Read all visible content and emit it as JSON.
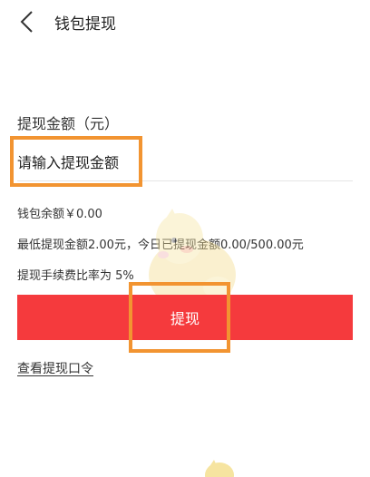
{
  "header": {
    "title": "钱包提现",
    "back_icon": "chevron-left-icon"
  },
  "form": {
    "amount_label": "提现金额（元）",
    "amount_placeholder": "请输入提现金额",
    "amount_value": ""
  },
  "info": {
    "balance": "钱包余额￥0.00",
    "min_and_today": "最低提现金额2.00元，今日已提现金额0.00/500.00元",
    "fee_rate": "提现手续费比率为 5%"
  },
  "actions": {
    "withdraw_label": "提现",
    "view_code_link": "查看提现口令"
  },
  "colors": {
    "primary_button": "#f53a3d",
    "highlight_border": "#f29431"
  }
}
